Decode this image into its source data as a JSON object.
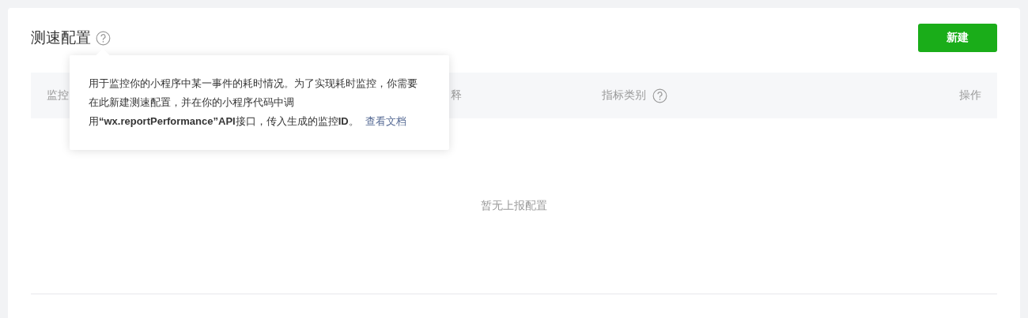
{
  "header": {
    "title": "测速配置",
    "new_button": "新建"
  },
  "tooltip": {
    "text": "用于监控你的小程序中某一事件的耗时情况。为了实现耗时监控，你需要在此新建测速配置，并在你的小程序代码中调用**“wx.reportPerformance”API**接口，传入生成的监控**ID**。",
    "link": "查看文档"
  },
  "table": {
    "columns": [
      {
        "label": "监控",
        "help": false
      },
      {
        "label": "释",
        "help": false
      },
      {
        "label": "指标类别",
        "help": true
      },
      {
        "label": "操作",
        "help": false
      }
    ],
    "empty_text": "暂无上报配置"
  }
}
